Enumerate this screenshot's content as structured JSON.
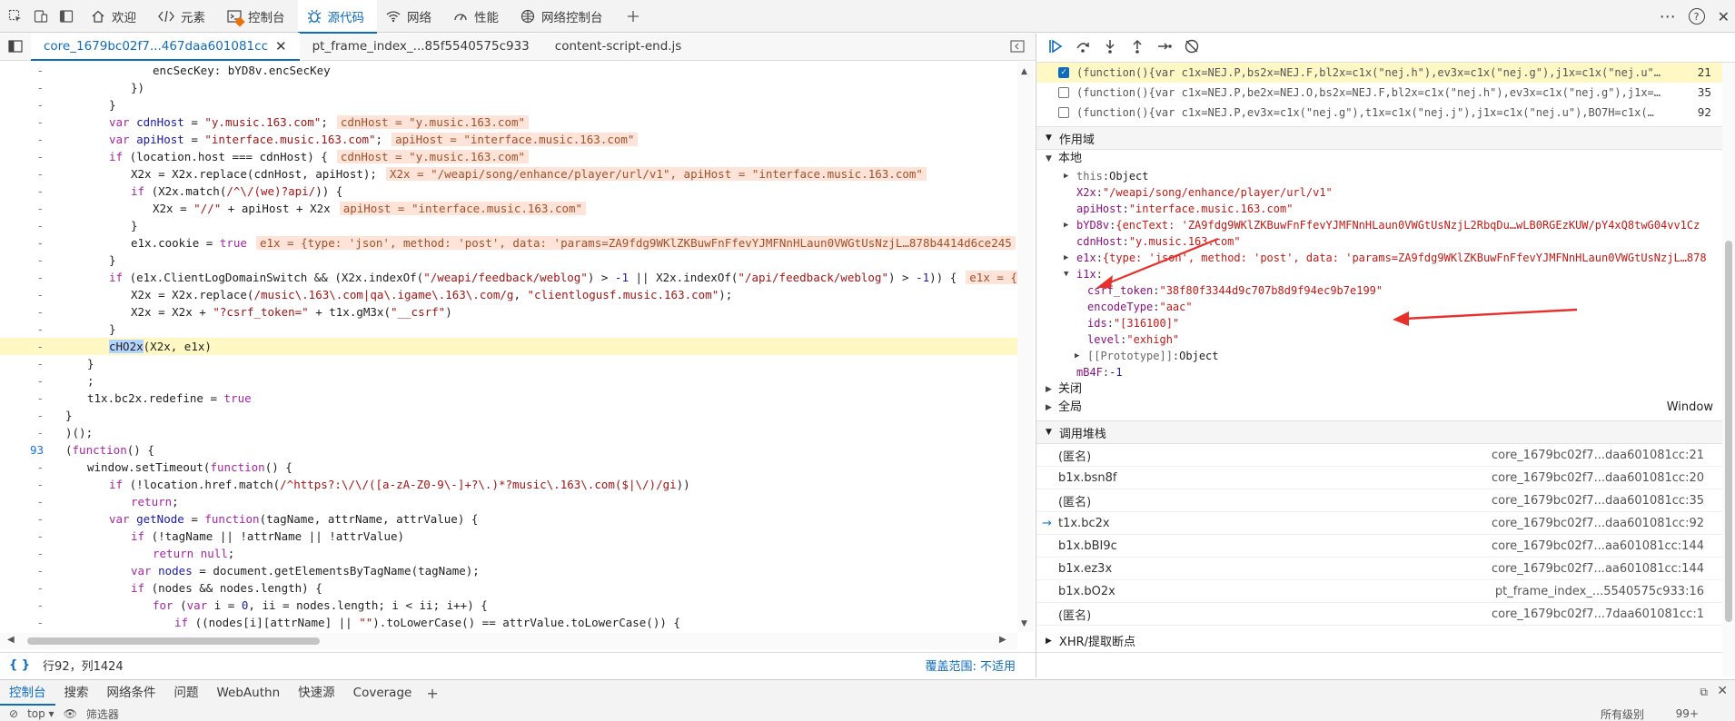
{
  "top_tabs": [
    {
      "label": "欢迎",
      "icon": "home-icon"
    },
    {
      "label": "元素",
      "icon": "code-tag-icon"
    },
    {
      "label": "控制台",
      "icon": "console-icon"
    },
    {
      "label": "源代码",
      "icon": "bug-icon"
    },
    {
      "label": "网络",
      "icon": "wifi-icon"
    },
    {
      "label": "性能",
      "icon": "performance-icon"
    },
    {
      "label": "网络控制台",
      "icon": "network-console-icon"
    }
  ],
  "active_top_tab": 3,
  "file_tabs": [
    {
      "label": "core_1679bc02f7...467daa601081cc",
      "active": true
    },
    {
      "label": "pt_frame_index_...85f5540575c933",
      "active": false
    },
    {
      "label": "content-script-end.js",
      "active": false
    }
  ],
  "code_lines": [
    {
      "g": "-",
      "i": 4,
      "t": [
        [
          "fn",
          "encSecKey: bYD8v.encSecKey"
        ]
      ]
    },
    {
      "g": "-",
      "i": 3,
      "t": [
        [
          "fn",
          "})"
        ]
      ]
    },
    {
      "g": "-",
      "i": 2,
      "t": [
        [
          "fn",
          "}"
        ]
      ]
    },
    {
      "g": "-",
      "i": 2,
      "t": [
        [
          "kw",
          "var "
        ],
        [
          "vr",
          "cdnHost"
        ],
        [
          "fn",
          " = "
        ],
        [
          "str",
          "\"y.music.163.com\""
        ],
        [
          "fn",
          ";"
        ]
      ],
      "inl": "cdnHost = \"y.music.163.com\""
    },
    {
      "g": "-",
      "i": 2,
      "t": [
        [
          "kw",
          "var "
        ],
        [
          "vr",
          "apiHost"
        ],
        [
          "fn",
          " = "
        ],
        [
          "str",
          "\"interface.music.163.com\""
        ],
        [
          "fn",
          ";"
        ]
      ],
      "inl": "apiHost = \"interface.music.163.com\""
    },
    {
      "g": "-",
      "i": 2,
      "t": [
        [
          "kw",
          "if "
        ],
        [
          "fn",
          "(location.host === cdnHost) {"
        ]
      ],
      "inl": "cdnHost = \"y.music.163.com\""
    },
    {
      "g": "-",
      "i": 3,
      "t": [
        [
          "fn",
          "X2x = X2x.replace(cdnHost, apiHost);"
        ]
      ],
      "inl": "X2x = \"/weapi/song/enhance/player/url/v1\", apiHost = \"interface.music.163.com\""
    },
    {
      "g": "-",
      "i": 3,
      "t": [
        [
          "kw",
          "if "
        ],
        [
          "fn",
          "(X2x.match("
        ],
        [
          "str",
          "/^\\/(we)?api/"
        ],
        [
          "fn",
          ")) {"
        ]
      ]
    },
    {
      "g": "-",
      "i": 4,
      "t": [
        [
          "fn",
          "X2x = "
        ],
        [
          "str",
          "\"//\""
        ],
        [
          "fn",
          " + apiHost + X2x"
        ]
      ],
      "inl": "apiHost = \"interface.music.163.com\""
    },
    {
      "g": "-",
      "i": 3,
      "t": [
        [
          "fn",
          "}"
        ]
      ]
    },
    {
      "g": "-",
      "i": 3,
      "t": [
        [
          "fn",
          "e1x.cookie = "
        ],
        [
          "kw",
          "true"
        ]
      ],
      "inl": "e1x = {type: 'json', method: 'post', data: 'params=ZA9fdg9WKlZKBuwFnFfevYJMFNnHLaun0VWGtUsNzjL…878b4414d6ce245"
    },
    {
      "g": "-",
      "i": 2,
      "t": [
        [
          "fn",
          "}"
        ]
      ]
    },
    {
      "g": "-",
      "i": 2,
      "t": [
        [
          "kw",
          "if "
        ],
        [
          "fn",
          "(e1x.ClientLogDomainSwitch && (X2x.indexOf("
        ],
        [
          "str",
          "\"/weapi/feedback/weblog\""
        ],
        [
          "fn",
          ") > "
        ],
        [
          "vr",
          "-1"
        ],
        [
          "fn",
          " || X2x.indexOf("
        ],
        [
          "str",
          "\"/api/feedback/weblog\""
        ],
        [
          "fn",
          ") > "
        ],
        [
          "vr",
          "-1"
        ],
        [
          "fn",
          ")) {"
        ]
      ],
      "inl": "e1x = {"
    },
    {
      "g": "-",
      "i": 3,
      "t": [
        [
          "fn",
          "X2x = X2x.replace("
        ],
        [
          "str",
          "/music\\.163\\.com|qa\\.igame\\.163\\.com/g"
        ],
        [
          "fn",
          ", "
        ],
        [
          "str",
          "\"clientlogusf.music.163.com\""
        ],
        [
          "fn",
          ");"
        ]
      ]
    },
    {
      "g": "-",
      "i": 3,
      "t": [
        [
          "fn",
          "X2x = X2x + "
        ],
        [
          "str",
          "\"?csrf_token=\""
        ],
        [
          "fn",
          " + t1x.gM3x("
        ],
        [
          "str",
          "\"__csrf\""
        ],
        [
          "fn",
          ")"
        ]
      ]
    },
    {
      "g": "-",
      "i": 2,
      "t": [
        [
          "fn",
          "}"
        ]
      ]
    },
    {
      "g": "-",
      "i": 2,
      "hl": true,
      "t": [
        [
          "sel",
          "cHO2x"
        ],
        [
          "fn",
          "(X2x, e1x)"
        ]
      ]
    },
    {
      "g": "-",
      "i": 1,
      "t": [
        [
          "fn",
          "}"
        ]
      ]
    },
    {
      "g": "-",
      "i": 1,
      "t": [
        [
          "fn",
          ";"
        ]
      ]
    },
    {
      "g": "-",
      "i": 1,
      "t": [
        [
          "fn",
          "t1x.bc2x.redefine = "
        ],
        [
          "kw",
          "true"
        ]
      ]
    },
    {
      "g": "-",
      "i": 0,
      "t": [
        [
          "fn",
          "}"
        ]
      ]
    },
    {
      "g": "-",
      "i": 0,
      "t": [
        [
          "fn",
          ")();"
        ]
      ]
    },
    {
      "g": "93",
      "i": 0,
      "bp": true,
      "t": [
        [
          "fn",
          "("
        ],
        [
          "kw",
          "function"
        ],
        [
          "fn",
          "() {"
        ]
      ]
    },
    {
      "g": "-",
      "i": 1,
      "t": [
        [
          "fn",
          "window.setTimeout("
        ],
        [
          "kw",
          "function"
        ],
        [
          "fn",
          "() {"
        ]
      ]
    },
    {
      "g": "-",
      "i": 2,
      "t": [
        [
          "kw",
          "if "
        ],
        [
          "fn",
          "(!location.href.match("
        ],
        [
          "str",
          "/^https?:\\/\\/([a-zA-Z0-9\\-]+?\\.)*?music\\.163\\.com($|\\/)/gi"
        ],
        [
          "fn",
          "))"
        ]
      ]
    },
    {
      "g": "-",
      "i": 3,
      "t": [
        [
          "kw",
          "return"
        ],
        [
          "fn",
          ";"
        ]
      ]
    },
    {
      "g": "-",
      "i": 2,
      "t": [
        [
          "kw",
          "var "
        ],
        [
          "vr",
          "getNode"
        ],
        [
          "fn",
          " = "
        ],
        [
          "kw",
          "function"
        ],
        [
          "fn",
          "(tagName, attrName, attrValue) {"
        ]
      ]
    },
    {
      "g": "-",
      "i": 3,
      "t": [
        [
          "kw",
          "if "
        ],
        [
          "fn",
          "(!tagName || !attrName || !attrValue)"
        ]
      ]
    },
    {
      "g": "-",
      "i": 4,
      "t": [
        [
          "kw",
          "return null"
        ],
        [
          "fn",
          ";"
        ]
      ]
    },
    {
      "g": "-",
      "i": 3,
      "t": [
        [
          "kw",
          "var "
        ],
        [
          "vr",
          "nodes"
        ],
        [
          "fn",
          " = document.getElementsByTagName(tagName);"
        ]
      ]
    },
    {
      "g": "-",
      "i": 3,
      "t": [
        [
          "kw",
          "if "
        ],
        [
          "fn",
          "(nodes && nodes.length) {"
        ]
      ]
    },
    {
      "g": "-",
      "i": 4,
      "t": [
        [
          "kw",
          "for "
        ],
        [
          "fn",
          "("
        ],
        [
          "kw",
          "var "
        ],
        [
          "fn",
          "i = "
        ],
        [
          "vr",
          "0"
        ],
        [
          "fn",
          ", ii = nodes.length; i < ii; i++) {"
        ]
      ]
    },
    {
      "g": "-",
      "i": 5,
      "t": [
        [
          "kw",
          "if "
        ],
        [
          "fn",
          "((nodes[i][attrName] || "
        ],
        [
          "str",
          "\"\""
        ],
        [
          "fn",
          ").toLowerCase() == attrValue.toLowerCase()) {"
        ]
      ]
    }
  ],
  "status": {
    "position": "行92，列1424",
    "coverage": "覆盖范围: 不适用",
    "brace_icon": "{ }"
  },
  "breakpoints": [
    {
      "text": "(function(){var c1x=NEJ.P,bs2x=NEJ.F,bl2x=c1x(\"nej.h\"),ev3x=c1x(\"nej.g\"),j1x=c1x(\"nej.u\"…",
      "line": "21",
      "checked": true
    },
    {
      "text": "(function(){var c1x=NEJ.P,be2x=NEJ.O,bs2x=NEJ.F,bl2x=c1x(\"nej.h\"),ev3x=c1x(\"nej.g\"),j1x=…",
      "line": "35",
      "checked": false
    },
    {
      "text": "(function(){var c1x=NEJ.P,ev3x=c1x(\"nej.g\"),t1x=c1x(\"nej.j\"),j1x=c1x(\"nej.u\"),BO7H=c1x(…",
      "line": "92",
      "checked": false
    }
  ],
  "scope_header": "作用域",
  "scope_local": "本地",
  "scope_rows": [
    {
      "d": 1,
      "tri": "▶",
      "k": "this",
      "kc": "pg",
      "v": "Object",
      "vc": "fn"
    },
    {
      "d": 1,
      "tri": "",
      "k": "X2x",
      "v": "\"/weapi/song/enhance/player/url/v1\"",
      "vc": "ps"
    },
    {
      "d": 1,
      "tri": "",
      "k": "apiHost",
      "v": "\"interface.music.163.com\"",
      "vc": "ps"
    },
    {
      "d": 1,
      "tri": "▶",
      "k": "bYD8v",
      "v": "{encText: 'ZA9fdg9WKlZKBuwFnFfevYJMFNnHLaun0VWGtUsNzjL2RbqDu…wLB0RGEzKUW/pY4xQ8twG04vv1Cz",
      "vc": "ps"
    },
    {
      "d": 1,
      "tri": "",
      "k": "cdnHost",
      "v": "\"y.music.163.com\"",
      "vc": "ps"
    },
    {
      "d": 1,
      "tri": "▶",
      "k": "e1x",
      "v": "{type: 'json', method: 'post', data: 'params=ZA9fdg9WKlZKBuwFnFfevYJMFNnHLaun0VWGtUsNzjL…878",
      "vc": "ps"
    },
    {
      "d": 1,
      "tri": "▼",
      "k": "i1x",
      "v": "",
      "vc": "fn"
    },
    {
      "d": 2,
      "tri": "",
      "k": "csrf_token",
      "v": "\"38f80f3344d9c707b8d9f94ec9b7e199\"",
      "vc": "ps"
    },
    {
      "d": 2,
      "tri": "",
      "k": "encodeType",
      "v": "\"aac\"",
      "vc": "ps"
    },
    {
      "d": 2,
      "tri": "",
      "k": "ids",
      "v": "\"[316100]\"",
      "vc": "ps"
    },
    {
      "d": 2,
      "tri": "",
      "k": "level",
      "v": "\"exhigh\"",
      "vc": "ps"
    },
    {
      "d": 2,
      "tri": "▶",
      "k": "[[Prototype]]",
      "kc": "pg",
      "v": "Object",
      "vc": "fn"
    },
    {
      "d": 1,
      "tri": "",
      "k": "mB4F",
      "v": "-1",
      "vc": "pv"
    }
  ],
  "scope_closed": "关闭",
  "scope_global": "全局",
  "scope_global_value": "Window",
  "callstack_header": "调用堆栈",
  "callstack": [
    {
      "fn": "(匿名)",
      "loc": "core_1679bc02f7...daa601081cc:21",
      "current": false
    },
    {
      "fn": "b1x.bsn8f",
      "loc": "core_1679bc02f7...daa601081cc:20",
      "current": false
    },
    {
      "fn": "(匿名)",
      "loc": "core_1679bc02f7...daa601081cc:35",
      "current": false
    },
    {
      "fn": "t1x.bc2x",
      "loc": "core_1679bc02f7...daa601081cc:92",
      "current": true
    },
    {
      "fn": "b1x.bBI9c",
      "loc": "core_1679bc02f7...aa601081cc:144",
      "current": false
    },
    {
      "fn": "b1x.ez3x",
      "loc": "core_1679bc02f7...aa601081cc:144",
      "current": false
    },
    {
      "fn": "b1x.bO2x",
      "loc": "pt_frame_index_...5540575c933:16",
      "current": false
    },
    {
      "fn": "(匿名)",
      "loc": "core_1679bc02f7...7daa601081cc:1",
      "current": false
    }
  ],
  "xhr_header": "XHR/提取断点",
  "drawer_tabs": [
    "控制台",
    "搜索",
    "网络条件",
    "问题",
    "WebAuthn",
    "快速源",
    "Coverage"
  ],
  "drawer_toolbar": {
    "context": "top",
    "filter": "筛选器",
    "levels": "所有级别",
    "count": "99+"
  },
  "colors": {
    "accent": "#0f6cbd",
    "highlight_line": "#fff8c5",
    "inline_value_bg": "#fde3d8",
    "annotation_arrow": "#e8302a"
  }
}
